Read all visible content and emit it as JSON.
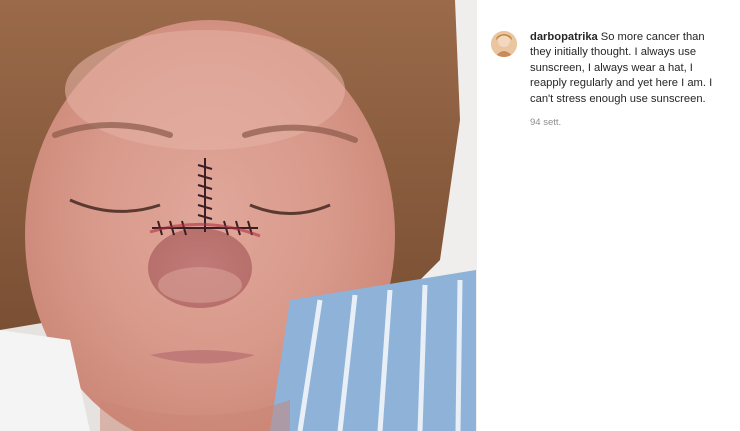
{
  "post": {
    "username": "darbopatrika",
    "caption": "So more cancer than they initially thought. I always use sunscreen, I always wear a hat, I reapply regularly and yet here I am. I can't stress enough use sunscreen.",
    "time_ago": "94 sett."
  },
  "colors": {
    "username": "#262626",
    "caption": "#262626",
    "time": "#8e8e8e",
    "divider": "#efefef"
  },
  "icons": {
    "avatar": "user-avatar-image"
  }
}
